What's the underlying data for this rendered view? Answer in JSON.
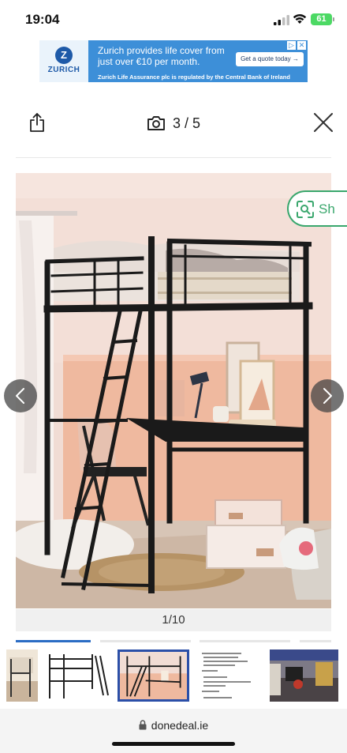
{
  "status_bar": {
    "time": "19:04",
    "battery": "61",
    "icons": [
      "signal-icon",
      "wifi-icon",
      "battery-icon"
    ]
  },
  "ad": {
    "brand": "ZURICH",
    "logo_letter": "Z",
    "headline": "Zurich provides life cover from just over €10 per month.",
    "cta": "Get a quote today →",
    "footer": "Zurich Life Assurance plc is regulated by the Central Bank of Ireland",
    "choices": [
      "▷",
      "✕"
    ],
    "colors": {
      "background": "#3d8fd8",
      "brand": "#1e5aa8"
    }
  },
  "header": {
    "counter": "3 / 5",
    "icons": [
      "share-icon",
      "camera-icon",
      "close-icon"
    ]
  },
  "photo": {
    "lens_label": "Sh",
    "page_indicator": "1/10",
    "icons": [
      "chevron-left-icon",
      "chevron-right-icon",
      "lens-icon"
    ]
  },
  "thumbnails": {
    "active_index": 2,
    "count": 5,
    "items": [
      "room-photo",
      "bed-frame-drawing",
      "bed-frame-room",
      "spec-sheet",
      "desk-room"
    ]
  },
  "browser": {
    "url": "donedeal.ie"
  },
  "colors": {
    "accent": "#2b6cc4",
    "lens_green": "#3aa76d"
  }
}
